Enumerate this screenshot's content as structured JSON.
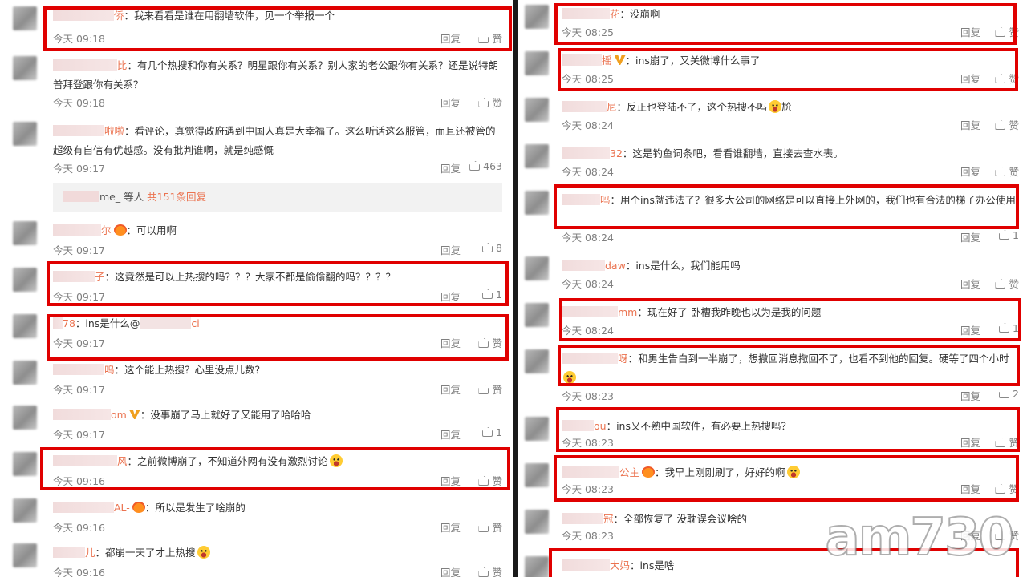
{
  "ui": {
    "reply_label": "回复",
    "like_label": "赞"
  },
  "left": {
    "comments": [
      {
        "suffix": "侨",
        "text": "：我来看看是谁在用翻墙软件，见一个举报一个",
        "time": "今天 09:18",
        "likes": "赞"
      },
      {
        "suffix": "比",
        "text": "：有几个热搜和你有关系？明星跟你有关系？别人家的老公跟你有关系？还是说特朗普拜登跟你有关系？",
        "time": "今天 09:18",
        "likes": "赞"
      },
      {
        "suffix": "啦啦",
        "text": "：看评论，真觉得政府遇到中国人真是大幸福了。这么听话这么服管，而且还被管的超级有自信有优越感。没有批判谁啊，就是纯感慨",
        "time": "今天 09:17",
        "likes": "463"
      },
      {
        "suffix": "尔",
        "text": "：可以用啊",
        "time": "今天 09:17",
        "likes": "8"
      },
      {
        "suffix": "子",
        "text": "：这竟然是可以上热搜的吗？？？大家不都是偷偷翻的吗？？？？",
        "time": "今天 09:17",
        "likes": "1"
      },
      {
        "suffix": "78",
        "text": "：ins是什么@",
        "mention_tail": "ci",
        "time": "今天 09:17",
        "likes": "赞"
      },
      {
        "suffix": "呜",
        "text": "：这个能上热搜？心里没点儿数？",
        "time": "今天 09:17",
        "likes": "赞"
      },
      {
        "suffix": "om",
        "text": "：没事崩了马上就好了又能用了哈哈哈",
        "time": "今天 09:17",
        "likes": "1"
      },
      {
        "suffix": "风",
        "text": "：之前微博崩了，不知道外网有没有激烈讨论",
        "time": "今天 09:16",
        "likes": "赞"
      },
      {
        "suffix": "AL-",
        "text": "：所以是发生了啥崩的",
        "time": "今天 09:16",
        "likes": "赞"
      },
      {
        "suffix": "儿",
        "text": "：都崩一天了才上热搜",
        "time": "今天 09:16",
        "likes": "赞"
      }
    ],
    "more_replies": {
      "suffix": "me_",
      "text": "等人",
      "count": "共151条回复"
    }
  },
  "right": {
    "comments": [
      {
        "suffix": "花",
        "text": "：没崩啊",
        "time": "今天 08:25",
        "likes": "赞"
      },
      {
        "suffix": "摇",
        "text": "：ins崩了，又关微博什么事了",
        "time": "今天 08:25",
        "likes": "赞"
      },
      {
        "suffix": "尼",
        "text": "：反正也登陆不了，这个热搜不吗",
        "text_tail": "尬",
        "time": "今天 08:24",
        "likes": "赞"
      },
      {
        "suffix": "32",
        "text": "：这是钓鱼词条吧，看看谁翻墙，直接去查水表。",
        "time": "今天 08:24",
        "likes": "赞"
      },
      {
        "suffix": "吗",
        "text": "：用个ins就违法了？很多大公司的网络是可以直接上外网的，我们也有合法的梯子办公使用",
        "time": "今天 08:24",
        "likes": "1"
      },
      {
        "suffix": "daw",
        "text": "：ins是什么，我们能用吗",
        "time": "今天 08:24",
        "likes": "赞"
      },
      {
        "suffix": "mm",
        "text": "：现在好了 卧槽我昨晚也以为是我的问题",
        "time": "今天 08:24",
        "likes": "1"
      },
      {
        "suffix": "呀",
        "text": "：和男生告白到一半崩了，想撤回消息撤回不了，也看不到他的回复。硬等了四个小时",
        "time": "今天 08:23",
        "likes": "2"
      },
      {
        "suffix": "ou",
        "text": "：ins又不熟中国软件，有必要上热搜吗？",
        "time": "今天 08:23",
        "likes": "赞"
      },
      {
        "suffix": "公主",
        "text": "：我早上刚刚刷了，好好的啊",
        "time": "今天 08:23",
        "likes": "赞"
      },
      {
        "suffix": "冠",
        "text": "：全部恢复了 没耽误会议啥的",
        "time": "今天 08:23",
        "likes": "赞"
      },
      {
        "suffix": "大妈",
        "text": "：ins是啥",
        "time": "",
        "likes": ""
      }
    ]
  },
  "watermark": "am730"
}
